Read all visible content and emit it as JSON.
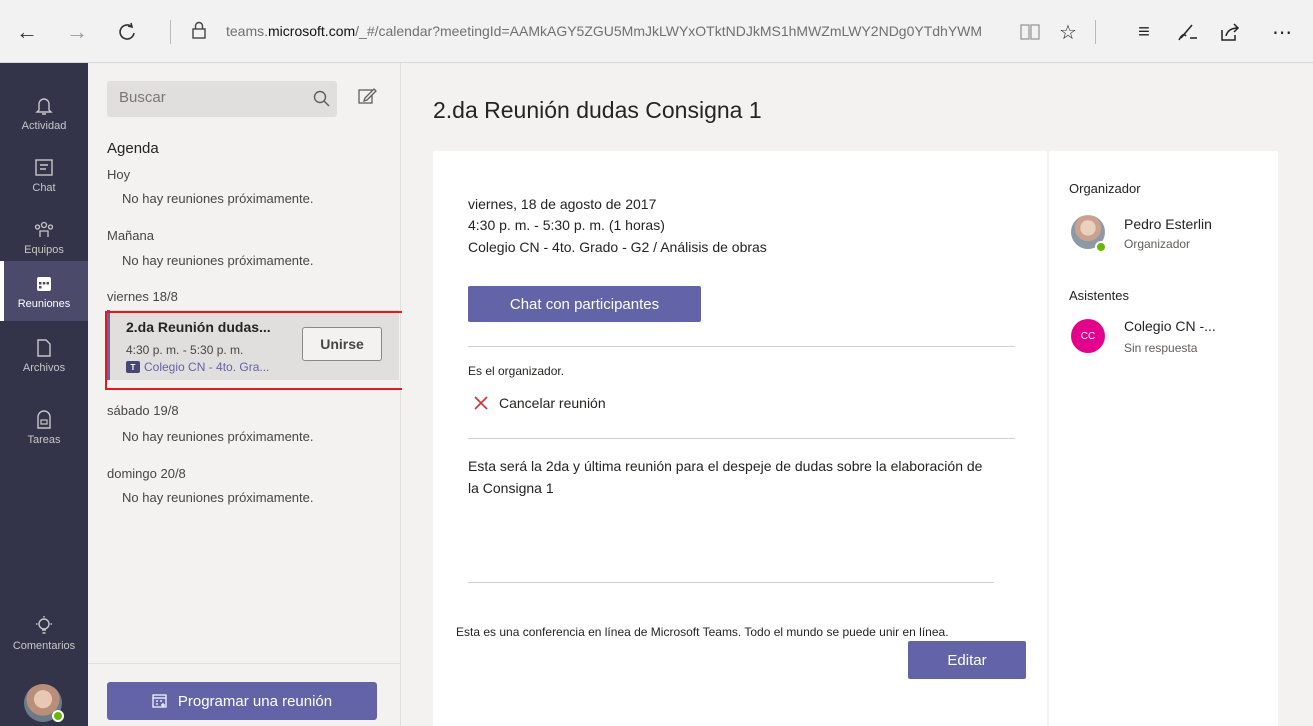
{
  "browser": {
    "url_prefix": "teams.",
    "url_domain": "microsoft.com",
    "url_rest": "/_#/calendar?meetingId=AAMkAGY5ZGU5MmJkLWYxOTktNDJkMS1hMWZmLWY2NDg0YTdhYWM"
  },
  "rail": {
    "items": [
      {
        "label": "Actividad"
      },
      {
        "label": "Chat"
      },
      {
        "label": "Equipos"
      },
      {
        "label": "Reuniones"
      },
      {
        "label": "Archivos"
      },
      {
        "label": "Tareas"
      }
    ],
    "feedback_label": "Comentarios"
  },
  "list": {
    "search_placeholder": "Buscar",
    "agenda_title": "Agenda",
    "days": [
      {
        "label": "Hoy",
        "empty": "No hay reuniones próximamente."
      },
      {
        "label": "Mañana",
        "empty": "No hay reuniones próximamente."
      },
      {
        "label": "viernes 18/8"
      },
      {
        "label": "sábado 19/8",
        "empty": "No hay reuniones próximamente."
      },
      {
        "label": "domingo 20/8",
        "empty": "No hay reuniones próximamente."
      }
    ],
    "meeting": {
      "title": "2.da Reunión dudas...",
      "time": "4:30 p. m. - 5:30 p. m.",
      "channel": "Colegio CN - 4to. Gra...",
      "join_label": "Unirse"
    },
    "schedule_label": "Programar una reunión"
  },
  "main": {
    "title": "2.da Reunión dudas Consigna 1",
    "date": "viernes, 18 de agosto de 2017",
    "time": "4:30 p. m. - 5:30 p. m. (1 horas)",
    "channel": "Colegio CN - 4to. Grado - G2 / Análisis de obras",
    "chat_button": "Chat con participantes",
    "organizer_note": "Es el organizador.",
    "cancel_label": "Cancelar reunión",
    "description": "Esta será la 2da y última reunión para el despeje de dudas sobre la elaboración de la Consigna 1",
    "conference_note": "Esta es una conferencia en línea de Microsoft Teams. Todo el mundo se puede unir en línea.",
    "edit_button": "Editar"
  },
  "side": {
    "organizer_heading": "Organizador",
    "organizer": {
      "name": "Pedro Esterlin",
      "role": "Organizador"
    },
    "attendees_heading": "Asistentes",
    "attendee": {
      "initials": "CC",
      "name": "Colegio CN -...",
      "status": "Sin respuesta"
    }
  },
  "colors": {
    "accent": "#6264a7",
    "rail": "#33344a",
    "highlight": "#e8171b",
    "attendee_avatar": "#e3008c",
    "presence": "#6bb700"
  }
}
